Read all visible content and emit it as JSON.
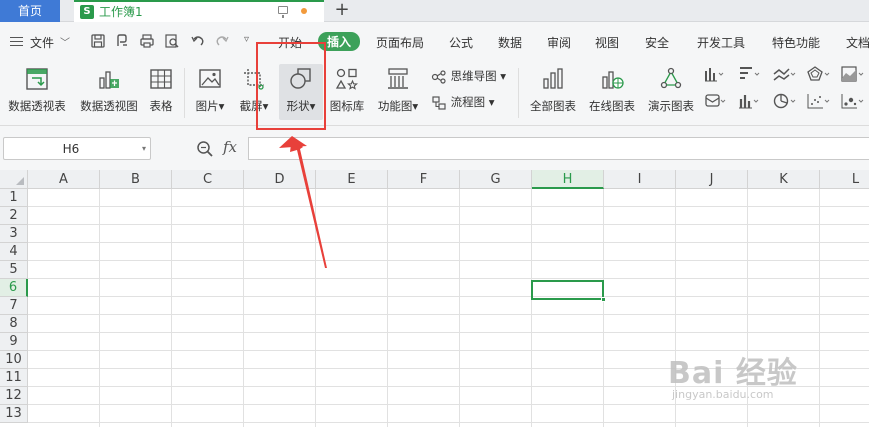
{
  "tabbar": {
    "home_label": "首页",
    "doc_icon_letter": "S",
    "doc_title": "工作簿1",
    "new_tab": "+"
  },
  "menu": {
    "file_label": "文件",
    "items": [
      "开始",
      "插入",
      "页面布局",
      "公式",
      "数据",
      "审阅",
      "视图",
      "安全",
      "开发工具",
      "特色功能",
      "文档"
    ],
    "active_item": "插入"
  },
  "ribbon": {
    "buttons": [
      "数据透视表",
      "数据透视图",
      "表格",
      "图片",
      "截屏",
      "形状",
      "图标库",
      "功能图"
    ],
    "small_buttons": [
      "思维导图",
      "流程图"
    ],
    "chart_buttons": [
      "全部图表",
      "在线图表",
      "演示图表"
    ],
    "highlighted": "形状"
  },
  "formula_bar": {
    "cell_ref": "H6",
    "fx_label": "fx",
    "formula_value": ""
  },
  "grid": {
    "columns": [
      "A",
      "B",
      "C",
      "D",
      "E",
      "F",
      "G",
      "H",
      "I",
      "J",
      "K",
      "L"
    ],
    "rows": [
      "1",
      "2",
      "3",
      "4",
      "5",
      "6",
      "7",
      "8",
      "9",
      "10",
      "11",
      "12",
      "13"
    ],
    "selected_column": "H",
    "selected_row": "6"
  },
  "watermark": {
    "brand": "Bai 经验",
    "site": "jingyan.baidu.com"
  },
  "colors": {
    "accent_green": "#2a9a4b",
    "home_tab_blue": "#3f7ad6",
    "annotation_red": "#e8403a"
  }
}
